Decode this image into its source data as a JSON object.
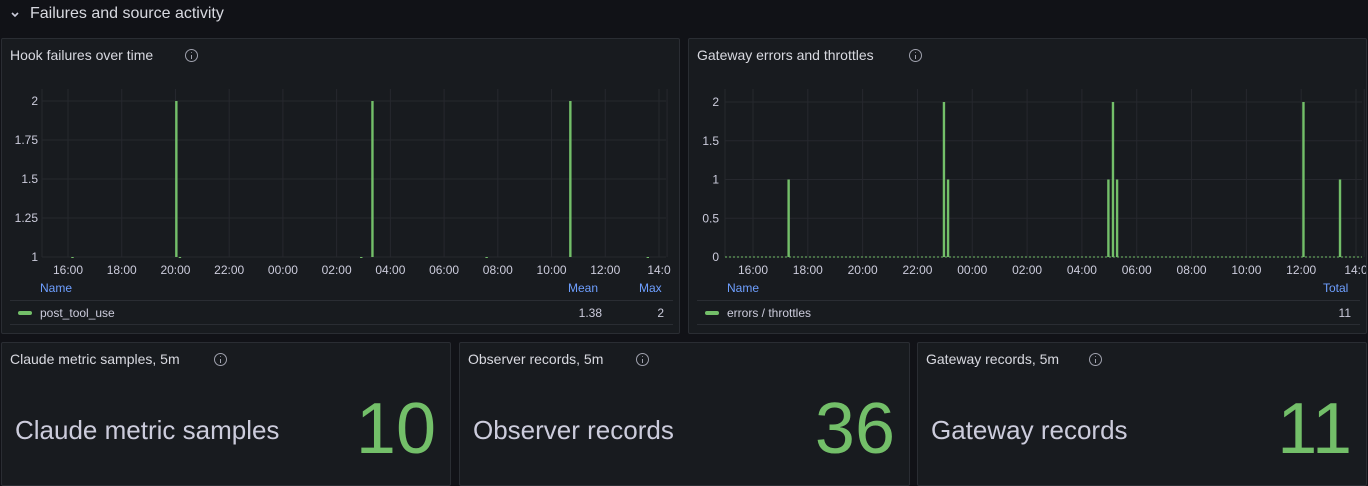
{
  "row": {
    "title": "Failures and source activity"
  },
  "hook_panel": {
    "title": "Hook failures over time",
    "legend": {
      "name_header": "Name",
      "mean_header": "Mean",
      "max_header": "Max",
      "series_name": "post_tool_use",
      "mean": "1.38",
      "max": "2"
    },
    "chart_data": {
      "type": "bar",
      "x_ticks": [
        "16:00",
        "18:00",
        "20:00",
        "22:00",
        "00:00",
        "02:00",
        "04:00",
        "06:00",
        "08:00",
        "10:00",
        "12:00",
        "14:0"
      ],
      "y_ticks": [
        "1",
        "1.25",
        "1.5",
        "1.75",
        "2"
      ],
      "ylim": [
        1,
        2
      ],
      "series": [
        {
          "name": "post_tool_use",
          "color": "#73bf69",
          "points": [
            {
              "t": "16:10",
              "v": 1
            },
            {
              "t": "20:02",
              "v": 2
            },
            {
              "t": "20:10",
              "v": 1
            },
            {
              "t": "02:55",
              "v": 1
            },
            {
              "t": "03:20",
              "v": 2
            },
            {
              "t": "07:35",
              "v": 1
            },
            {
              "t": "10:42",
              "v": 2
            },
            {
              "t": "13:35",
              "v": 1
            }
          ]
        }
      ],
      "grid": true
    }
  },
  "gateway_panel": {
    "title": "Gateway errors and throttles",
    "legend": {
      "name_header": "Name",
      "total_header": "Total",
      "series_name": "errors / throttles",
      "total": "11"
    },
    "chart_data": {
      "type": "bar",
      "x_ticks": [
        "16:00",
        "18:00",
        "20:00",
        "22:00",
        "00:00",
        "02:00",
        "04:00",
        "06:00",
        "08:00",
        "10:00",
        "12:00",
        "14:0"
      ],
      "y_ticks": [
        "0",
        "0.5",
        "1",
        "1.5",
        "2"
      ],
      "ylim": [
        0,
        2
      ],
      "series": [
        {
          "name": "errors / throttles",
          "color": "#73bf69",
          "points": [
            {
              "t": "17:18",
              "v": 1
            },
            {
              "t": "22:58",
              "v": 2
            },
            {
              "t": "23:07",
              "v": 1
            },
            {
              "t": "04:58",
              "v": 1
            },
            {
              "t": "05:08",
              "v": 2
            },
            {
              "t": "05:17",
              "v": 1
            },
            {
              "t": "12:05",
              "v": 2
            },
            {
              "t": "13:25",
              "v": 1
            }
          ]
        }
      ],
      "grid": true
    }
  },
  "stats": [
    {
      "title": "Claude metric samples, 5m",
      "label": "Claude metric samples",
      "value": "10"
    },
    {
      "title": "Observer records, 5m",
      "label": "Observer records",
      "value": "36"
    },
    {
      "title": "Gateway records, 5m",
      "label": "Gateway records",
      "value": "11"
    }
  ],
  "colors": {
    "accent": "#73bf69",
    "link": "#6e9fff",
    "background": "#111217",
    "panel": "#181b1f"
  }
}
